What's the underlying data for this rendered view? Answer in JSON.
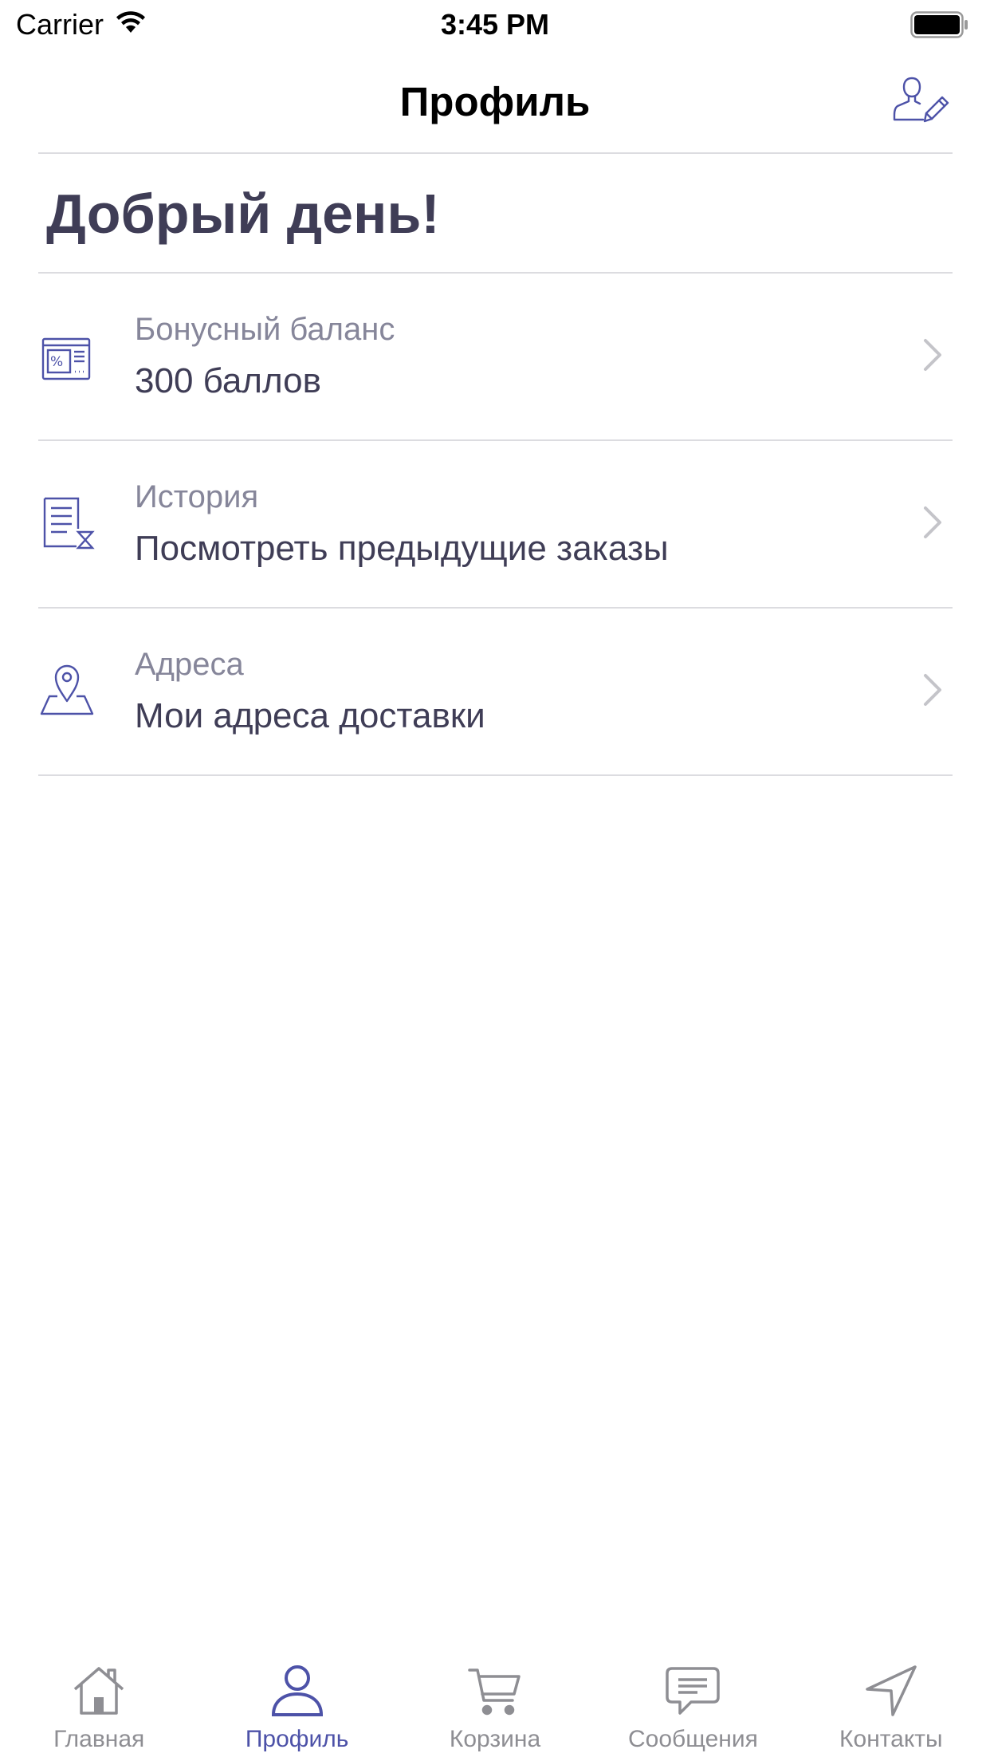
{
  "status_bar": {
    "carrier": "Carrier",
    "time": "3:45 PM"
  },
  "nav": {
    "title": "Профиль",
    "edit_icon": "user-edit-icon"
  },
  "greeting": "Добрый день!",
  "menu": [
    {
      "icon": "bonus-card-icon",
      "caption": "Бонусный баланс",
      "value": "300 баллов"
    },
    {
      "icon": "order-history-icon",
      "caption": "История",
      "value": "Посмотреть предыдущие заказы"
    },
    {
      "icon": "map-pin-icon",
      "caption": "Адреса",
      "value": "Мои адреса доставки"
    }
  ],
  "tabs": [
    {
      "label": "Главная",
      "icon": "home-icon",
      "active": false
    },
    {
      "label": "Профиль",
      "icon": "user-icon",
      "active": true
    },
    {
      "label": "Корзина",
      "icon": "cart-icon",
      "active": false
    },
    {
      "label": "Сообщения",
      "icon": "chat-icon",
      "active": false
    },
    {
      "label": "Контакты",
      "icon": "navigation-arrow-icon",
      "active": false
    }
  ],
  "colors": {
    "accent": "#4d52a8",
    "text_primary": "#3f3d56",
    "text_secondary": "#86869a",
    "tab_inactive": "#8e8e93",
    "divider": "#dcdce0"
  }
}
